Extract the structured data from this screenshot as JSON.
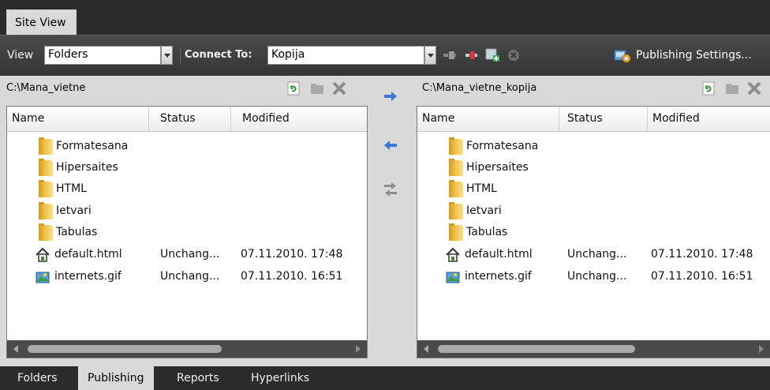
{
  "top_tab": {
    "label": "Site View"
  },
  "toolbar": {
    "view_label": "View",
    "view_value": "Folders",
    "connect_label": "Connect To:",
    "connect_value": "Kopija",
    "publishing_settings_label": "Publishing Settings..."
  },
  "local": {
    "path": "C:\\Mana_vietne",
    "columns": [
      "Name",
      "Status",
      "Modified"
    ],
    "rows": [
      {
        "icon": "folder-icon",
        "name": "Formatesana",
        "status": "",
        "modified": ""
      },
      {
        "icon": "folder-icon",
        "name": "Hipersaites",
        "status": "",
        "modified": ""
      },
      {
        "icon": "folder-icon",
        "name": "HTML",
        "status": "",
        "modified": ""
      },
      {
        "icon": "folder-icon",
        "name": "Ietvari",
        "status": "",
        "modified": ""
      },
      {
        "icon": "folder-icon",
        "name": "Tabulas",
        "status": "",
        "modified": ""
      },
      {
        "icon": "home-page-icon",
        "name": "default.html",
        "status": "Unchang...",
        "modified": "07.11.2010. 17:48"
      },
      {
        "icon": "image-file-icon",
        "name": "internets.gif",
        "status": "Unchang...",
        "modified": "07.11.2010. 16:51"
      }
    ]
  },
  "remote": {
    "path": "C:\\Mana_vietne_kopija",
    "columns": [
      "Name",
      "Status",
      "Modified"
    ],
    "rows": [
      {
        "icon": "folder-icon",
        "name": "Formatesana",
        "status": "",
        "modified": ""
      },
      {
        "icon": "folder-icon",
        "name": "Hipersaites",
        "status": "",
        "modified": ""
      },
      {
        "icon": "folder-icon",
        "name": "HTML",
        "status": "",
        "modified": ""
      },
      {
        "icon": "folder-icon",
        "name": "Ietvari",
        "status": "",
        "modified": ""
      },
      {
        "icon": "folder-icon",
        "name": "Tabulas",
        "status": "",
        "modified": ""
      },
      {
        "icon": "home-page-icon",
        "name": "default.html",
        "status": "Unchang...",
        "modified": "07.11.2010. 17:48"
      },
      {
        "icon": "image-file-icon",
        "name": "internets.gif",
        "status": "Unchang...",
        "modified": "07.11.2010. 16:51"
      }
    ]
  },
  "bottom_tabs": [
    {
      "label": "Folders",
      "active": false
    },
    {
      "label": "Publishing",
      "active": true
    },
    {
      "label": "Reports",
      "active": false
    },
    {
      "label": "Hyperlinks",
      "active": false
    }
  ],
  "colors": {
    "accent_blue": "#3b78d8",
    "chrome_dark": "#2b2b2b",
    "panel": "#d9d9d9"
  }
}
